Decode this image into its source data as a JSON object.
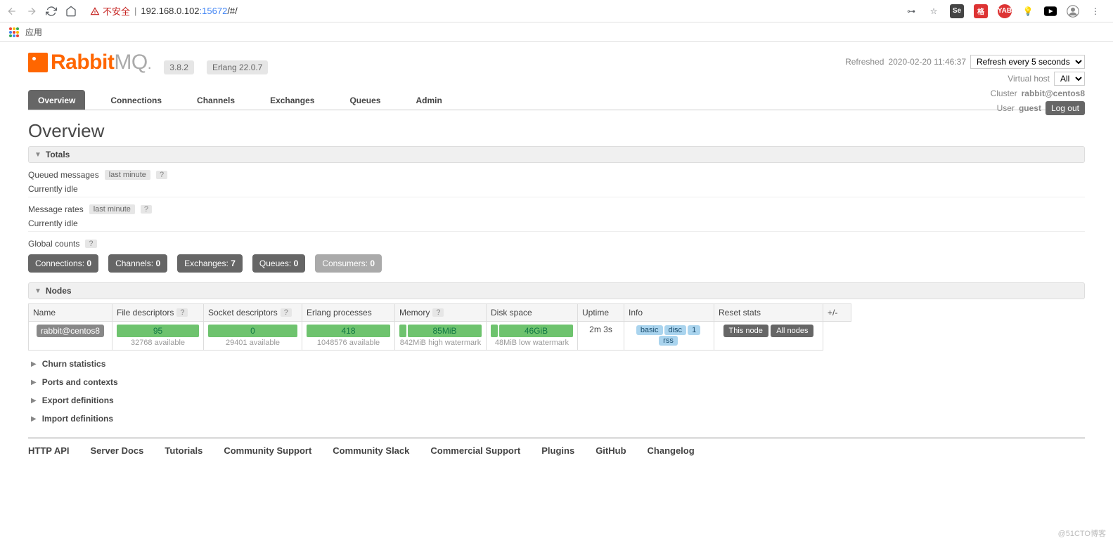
{
  "browser": {
    "not_secure": "不安全",
    "url_host": "192.168.0.102",
    "url_port": ":15672",
    "url_path": "/#/",
    "apps_label": "应用"
  },
  "header": {
    "logo_left": "Rabbit",
    "logo_right": "MQ",
    "version": "3.8.2",
    "erlang": "Erlang 22.0.7"
  },
  "top_right": {
    "refreshed_label": "Refreshed",
    "refreshed_time": "2020-02-20 11:46:37",
    "refresh_select": "Refresh every 5 seconds",
    "vhost_label": "Virtual host",
    "vhost_value": "All",
    "cluster_label": "Cluster",
    "cluster_value": "rabbit@centos8",
    "user_label": "User",
    "user_value": "guest",
    "logout": "Log out"
  },
  "nav": {
    "overview": "Overview",
    "connections": "Connections",
    "channels": "Channels",
    "exchanges": "Exchanges",
    "queues": "Queues",
    "admin": "Admin"
  },
  "page_title": "Overview",
  "totals": {
    "section": "Totals",
    "queued_label": "Queued messages",
    "last_minute": "last minute",
    "idle1": "Currently idle",
    "rates_label": "Message rates",
    "idle2": "Currently idle",
    "global_counts": "Global counts"
  },
  "counts": {
    "connections_label": "Connections:",
    "connections_val": "0",
    "channels_label": "Channels:",
    "channels_val": "0",
    "exchanges_label": "Exchanges:",
    "exchanges_val": "7",
    "queues_label": "Queues:",
    "queues_val": "0",
    "consumers_label": "Consumers:",
    "consumers_val": "0"
  },
  "nodes": {
    "section": "Nodes",
    "pm": "+/-",
    "cols": {
      "name": "Name",
      "fd": "File descriptors",
      "sd": "Socket descriptors",
      "ep": "Erlang processes",
      "mem": "Memory",
      "disk": "Disk space",
      "uptime": "Uptime",
      "info": "Info",
      "reset": "Reset stats"
    },
    "row": {
      "name": "rabbit@centos8",
      "fd": "95",
      "fd_avail": "32768 available",
      "sd": "0",
      "sd_avail": "29401 available",
      "ep": "418",
      "ep_avail": "1048576 available",
      "mem": "85MiB",
      "mem_sub": "842MiB high watermark",
      "disk": "46GiB",
      "disk_sub": "48MiB low watermark",
      "uptime": "2m 3s",
      "info_basic": "basic",
      "info_disc": "disc",
      "info_1": "1",
      "info_rss": "rss",
      "reset_this": "This node",
      "reset_all": "All nodes"
    }
  },
  "collapsed": {
    "churn": "Churn statistics",
    "ports": "Ports and contexts",
    "export": "Export definitions",
    "import": "Import definitions"
  },
  "footer": {
    "api": "HTTP API",
    "docs": "Server Docs",
    "tutorials": "Tutorials",
    "csupport": "Community Support",
    "cslack": "Community Slack",
    "commsupport": "Commercial Support",
    "plugins": "Plugins",
    "github": "GitHub",
    "changelog": "Changelog"
  },
  "watermark": "@51CTO博客"
}
